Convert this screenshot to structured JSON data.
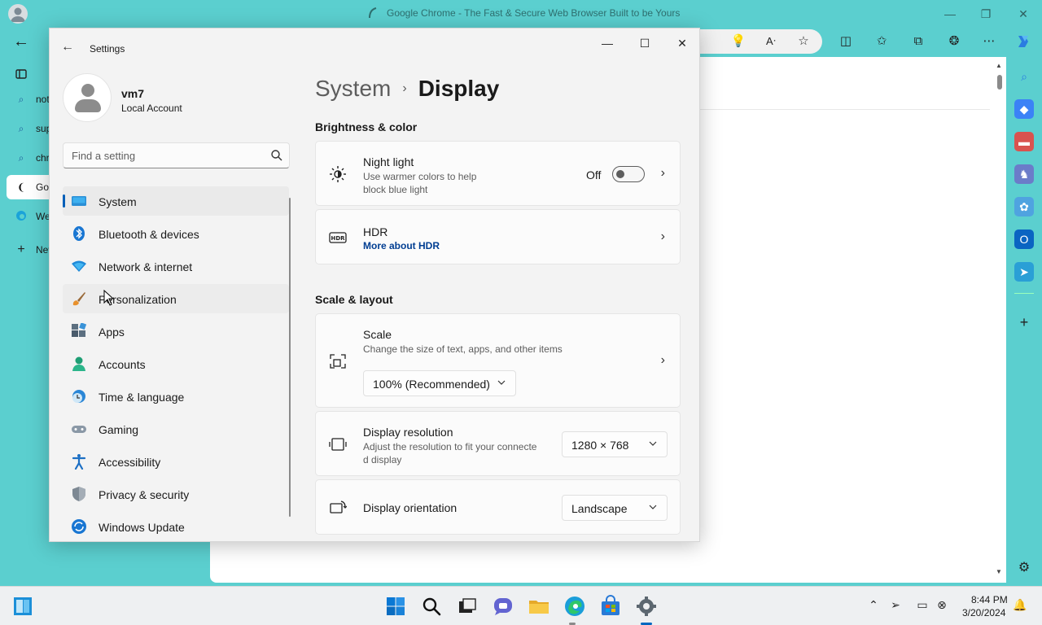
{
  "browser": {
    "title": "Google Chrome - The Fast & Secure Web Browser Built to be Yours",
    "tabs": [
      {
        "label": "not",
        "icon": "search-icon"
      },
      {
        "label": "sup",
        "icon": "search-icon"
      },
      {
        "label": "chr",
        "icon": "search-icon"
      },
      {
        "label": "Goo",
        "icon": "chrome-icon"
      },
      {
        "label": "We",
        "icon": "edge-icon"
      },
      {
        "label": "Nev",
        "icon": "plus-icon"
      }
    ]
  },
  "settings": {
    "app_title": "Settings",
    "user": {
      "name": "vm7",
      "account_type": "Local Account"
    },
    "search": {
      "placeholder": "Find a setting"
    },
    "nav": [
      {
        "label": "System",
        "icon": "system-icon",
        "selected": true
      },
      {
        "label": "Bluetooth & devices",
        "icon": "bluetooth-icon"
      },
      {
        "label": "Network & internet",
        "icon": "network-icon"
      },
      {
        "label": "Personalization",
        "icon": "brush-icon"
      },
      {
        "label": "Apps",
        "icon": "apps-icon"
      },
      {
        "label": "Accounts",
        "icon": "accounts-icon"
      },
      {
        "label": "Time & language",
        "icon": "time-icon"
      },
      {
        "label": "Gaming",
        "icon": "gaming-icon"
      },
      {
        "label": "Accessibility",
        "icon": "accessibility-icon"
      },
      {
        "label": "Privacy & security",
        "icon": "shield-icon"
      },
      {
        "label": "Windows Update",
        "icon": "update-icon"
      }
    ],
    "breadcrumb": {
      "parent": "System",
      "separator": "›",
      "current": "Display"
    },
    "sections": {
      "brightness": "Brightness & color",
      "scale_layout": "Scale & layout"
    },
    "night_light": {
      "title": "Night light",
      "subtitle_line1": "Use warmer colors to help",
      "subtitle_line2": "block blue light",
      "state": "Off"
    },
    "hdr": {
      "title": "HDR",
      "link": "More about HDR"
    },
    "scale": {
      "title": "Scale",
      "subtitle": "Change the size of text, apps, and other items",
      "value": "100% (Recommended)"
    },
    "resolution": {
      "title": "Display resolution",
      "subtitle_line1": "Adjust the resolution to fit your connecte",
      "subtitle_line2": "d display",
      "value": "1280 × 768"
    },
    "orientation": {
      "title": "Display orientation",
      "value": "Landscape"
    }
  },
  "taskbar": {
    "time": "8:44 PM",
    "date": "3/20/2024"
  },
  "colors": {
    "desktop": "#5bcfcf",
    "accent": "#005fb8",
    "link": "#003e92"
  }
}
